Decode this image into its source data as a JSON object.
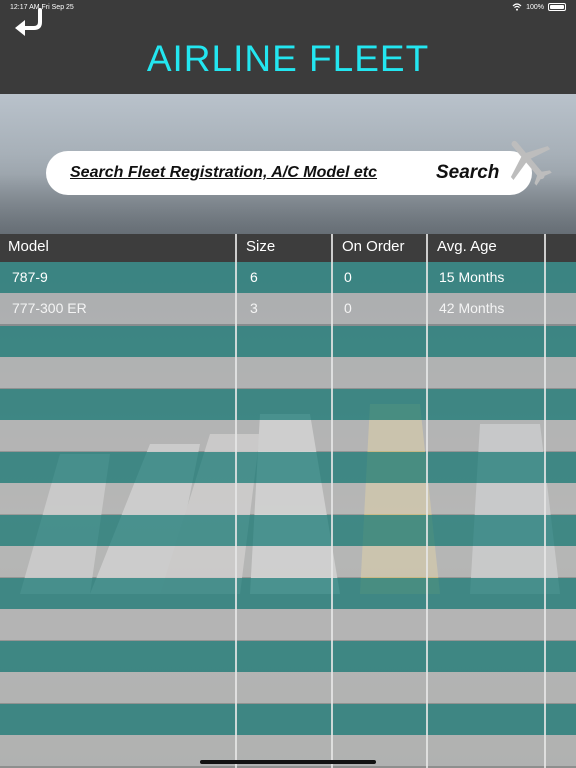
{
  "status_bar": {
    "time": "12:17 AM",
    "date": "Fri Sep 25",
    "battery": "100%"
  },
  "header": {
    "title": "AIRLINE FLEET",
    "back_icon": "back-arrow-icon"
  },
  "search": {
    "placeholder": "Search Fleet Registration, A/C Model etc",
    "button_label": "Search",
    "icon": "airplane-icon"
  },
  "colors": {
    "header_bg": "#3b3b3b",
    "title": "#23e6f0",
    "row_teal": "#2c8480",
    "table_header_bg": "#3d3d3d"
  },
  "table": {
    "columns": [
      "Model",
      "Size",
      "On Order",
      "Avg. Age"
    ],
    "rows": [
      {
        "model": "787-9",
        "size": "6",
        "on_order": "0",
        "avg_age": "15 Months"
      },
      {
        "model": "777-300 ER",
        "size": "3",
        "on_order": "0",
        "avg_age": "42 Months"
      }
    ]
  }
}
